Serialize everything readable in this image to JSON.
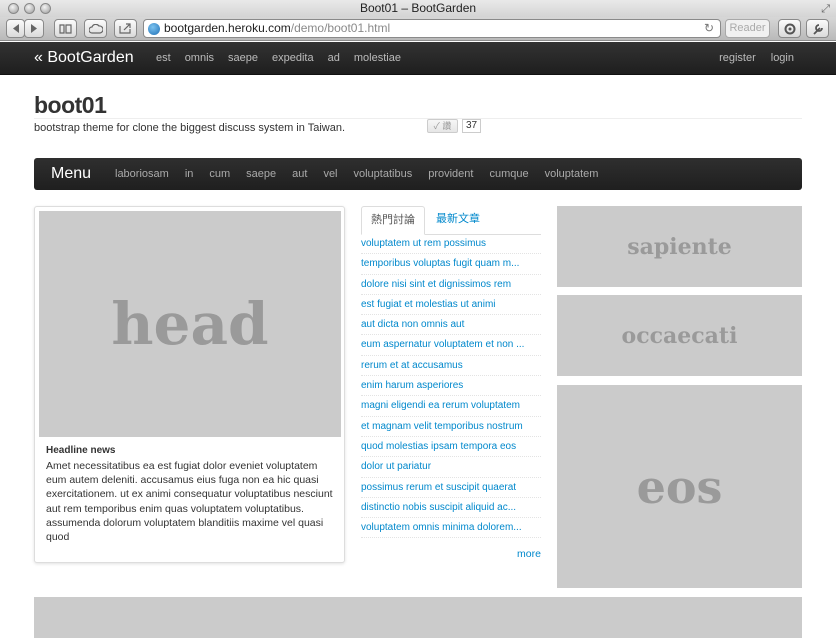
{
  "browser": {
    "window_title": "Boot01 – BootGarden",
    "url_domain": "bootgarden.heroku.com",
    "url_path": "/demo/boot01.html",
    "reader_label": "Reader",
    "reload_glyph": "↻"
  },
  "navbar": {
    "brand": "« BootGarden",
    "links": [
      "est",
      "omnis",
      "saepe",
      "expedita",
      "ad",
      "molestiae"
    ],
    "right_links": [
      "register",
      "login"
    ]
  },
  "header": {
    "title": "boot01",
    "subtitle": "bootstrap theme for clone the biggest discuss system in Taiwan.",
    "like_label": "✓ 讚",
    "like_count": "37"
  },
  "menubar": {
    "brand": "Menu",
    "links": [
      "laboriosam",
      "in",
      "cum",
      "saepe",
      "aut",
      "vel",
      "voluptatibus",
      "provident",
      "cumque",
      "voluptatem"
    ]
  },
  "headline": {
    "image_text": "head",
    "heading": "Headline news",
    "text": "Amet necessitatibus ea est fugiat dolor eveniet voluptatem eum autem deleniti. accusamus eius fuga non ea hic quasi exercitationem. ut ex animi consequatur voluptatibus nesciunt aut rem temporibus enim quas voluptatem voluptatibus. assumenda dolorum voluptatem blanditiis maxime vel quasi quod"
  },
  "tabs": {
    "active": "熱門討論",
    "inactive": "最新文章"
  },
  "topics": [
    "voluptatem ut rem possimus",
    "temporibus voluptas fugit quam m...",
    "dolore nisi sint et dignissimos rem",
    "est fugiat et molestias ut animi",
    "aut dicta non omnis aut",
    "eum aspernatur voluptatem et non ...",
    "rerum et at accusamus",
    "enim harum asperiores",
    "magni eligendi ea rerum voluptatem",
    "et magnam velit temporibus nostrum",
    "quod molestias ipsam tempora eos",
    "dolor ut pariatur",
    "possimus rerum et suscipit quaerat",
    "distinctio nobis suscipit aliquid ac...",
    "voluptatem omnis minima dolorem..."
  ],
  "more_label": "more",
  "placeholders": {
    "right_1": "sapiente",
    "right_2": "occaecati",
    "right_3": "eos"
  }
}
